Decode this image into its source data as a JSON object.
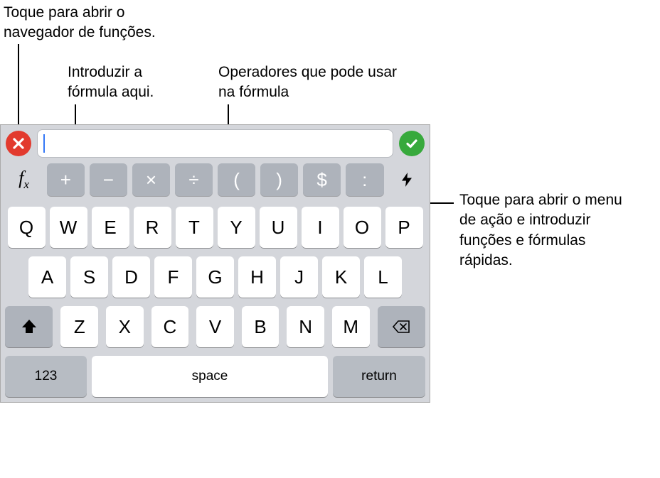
{
  "callouts": {
    "fx": "Toque para abrir o navegador de funções.",
    "formula": "Introduzir a fórmula aqui.",
    "operators": "Operadores que pode usar na fórmula",
    "bolt": "Toque para abrir o menu de ação e introduzir funções e fórmulas rápidas."
  },
  "formula_bar": {
    "input_value": ""
  },
  "icons": {
    "fx_f": "f",
    "fx_x": "x"
  },
  "operators": [
    "+",
    "−",
    "×",
    "÷",
    "(",
    ")",
    "$",
    ":"
  ],
  "keyboard": {
    "row1": [
      "Q",
      "W",
      "E",
      "R",
      "T",
      "Y",
      "U",
      "I",
      "O",
      "P"
    ],
    "row2": [
      "A",
      "S",
      "D",
      "F",
      "G",
      "H",
      "J",
      "K",
      "L"
    ],
    "row3": [
      "Z",
      "X",
      "C",
      "V",
      "B",
      "N",
      "M"
    ],
    "num_label": "123",
    "space_label": "space",
    "return_label": "return"
  }
}
